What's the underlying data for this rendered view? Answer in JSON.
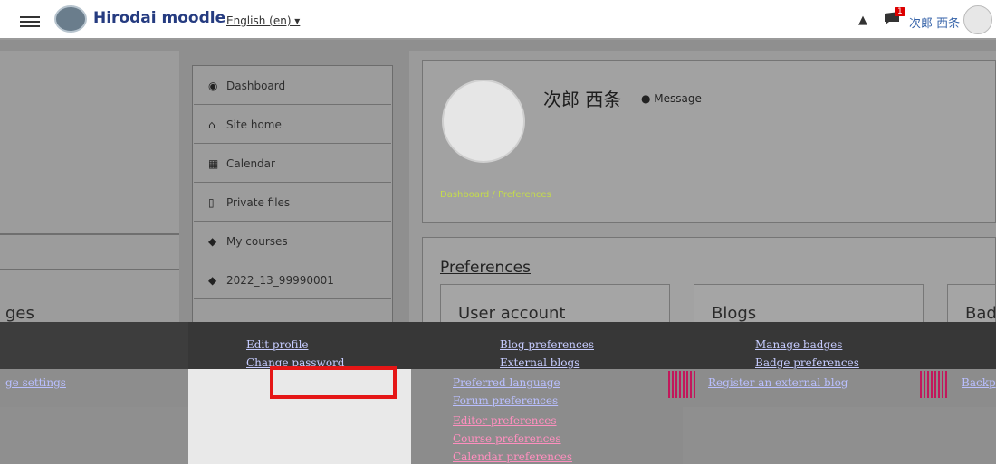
{
  "navbar": {
    "site_name": "Hirodai moodle",
    "language": "English (en) ▾",
    "notification_count": "1",
    "user_name": "次郎 西条",
    "icons": [
      "menu-icon",
      "bell-icon",
      "chat-icon"
    ]
  },
  "nav": {
    "items": [
      {
        "label": "Dashboard",
        "icon": "tachometer-icon"
      },
      {
        "label": "Site home",
        "icon": "home-icon"
      },
      {
        "label": "Calendar",
        "icon": "calendar-icon"
      },
      {
        "label": "Private files",
        "icon": "file-icon"
      },
      {
        "label": "My courses",
        "icon": "graduation-cap-icon"
      },
      {
        "label": "2022_13_99990001",
        "icon": "graduation-cap-icon"
      }
    ]
  },
  "left": {
    "partial_heading": "ges",
    "partial_link": "ge settings"
  },
  "profile": {
    "name": "次郎 西条",
    "message_label": "Message",
    "breadcrumb": "Dashboard / Preferences"
  },
  "preferences": {
    "title": "Preferences",
    "user_account": {
      "title": "User account",
      "links": [
        "Edit profile",
        "Change password",
        "Preferred language",
        "Forum preferences",
        "Editor preferences",
        "Course preferences",
        "Calendar preferences"
      ]
    },
    "blogs": {
      "title": "Blogs",
      "links": [
        "Blog preferences",
        "External blogs",
        "Register an external blog"
      ]
    },
    "badges": {
      "title": "Bad",
      "links": [
        "Manage badges",
        "Badge preferences",
        "Backp"
      ]
    }
  },
  "colors": {
    "highlight": "#e51616",
    "link": "#c6ccff",
    "badge": "#dd0000"
  }
}
